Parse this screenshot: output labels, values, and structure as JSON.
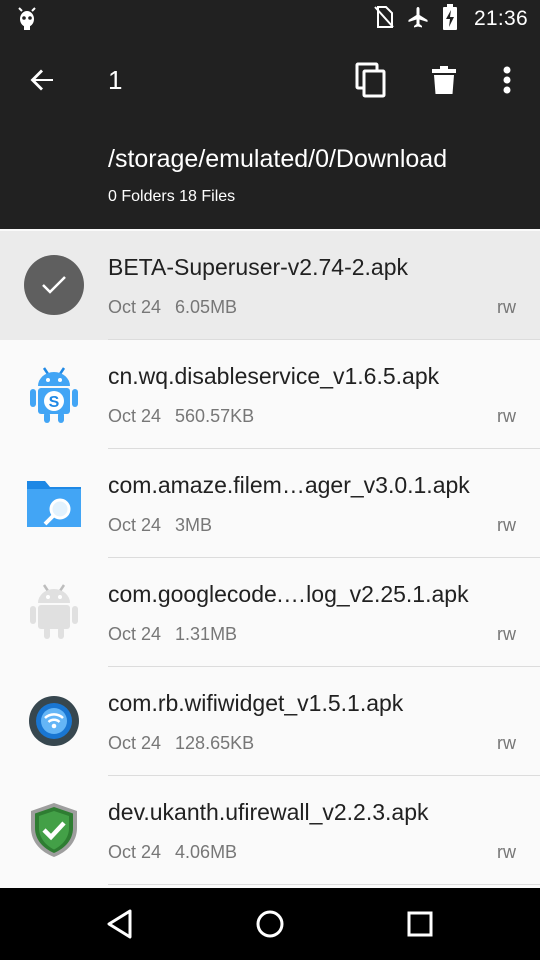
{
  "status_bar": {
    "time": "21:36",
    "icons": [
      "android-debug-icon",
      "no-sim-icon",
      "airplane-mode-icon",
      "battery-charging-icon"
    ]
  },
  "app_bar": {
    "selection_count": "1",
    "path": "/storage/emulated/0/Download",
    "summary": "0 Folders 18 Files",
    "actions": [
      "copy-icon",
      "delete-icon",
      "more-options-icon"
    ]
  },
  "files": [
    {
      "name": "BETA-Superuser-v2.74-2.apk",
      "date": "Oct 24",
      "size": "6.05MB",
      "perm": "rw",
      "selected": true,
      "icon": "checkmark-icon"
    },
    {
      "name": "cn.wq.disableservice_v1.6.5.apk",
      "date": "Oct 24",
      "size": "560.57KB",
      "perm": "rw",
      "selected": false,
      "icon": "android-app-icon"
    },
    {
      "name": "com.amaze.filem…ager_v3.0.1.apk",
      "date": "Oct 24",
      "size": "3MB",
      "perm": "rw",
      "selected": false,
      "icon": "folder-search-icon"
    },
    {
      "name": "com.googlecode.…log_v2.25.1.apk",
      "date": "Oct 24",
      "size": "1.31MB",
      "perm": "rw",
      "selected": false,
      "icon": "android-default-icon"
    },
    {
      "name": "com.rb.wifiwidget_v1.5.1.apk",
      "date": "Oct 24",
      "size": "128.65KB",
      "perm": "rw",
      "selected": false,
      "icon": "wifi-icon"
    },
    {
      "name": "dev.ukanth.ufirewall_v2.2.3.apk",
      "date": "Oct 24",
      "size": "4.06MB",
      "perm": "rw",
      "selected": false,
      "icon": "shield-check-icon"
    }
  ],
  "nav_bar": {
    "buttons": [
      "back-triangle-icon",
      "home-circle-icon",
      "recents-square-icon"
    ]
  },
  "colors": {
    "bar_dark": "#212121",
    "selected_row": "#ebebeb",
    "background": "#fafafa"
  }
}
